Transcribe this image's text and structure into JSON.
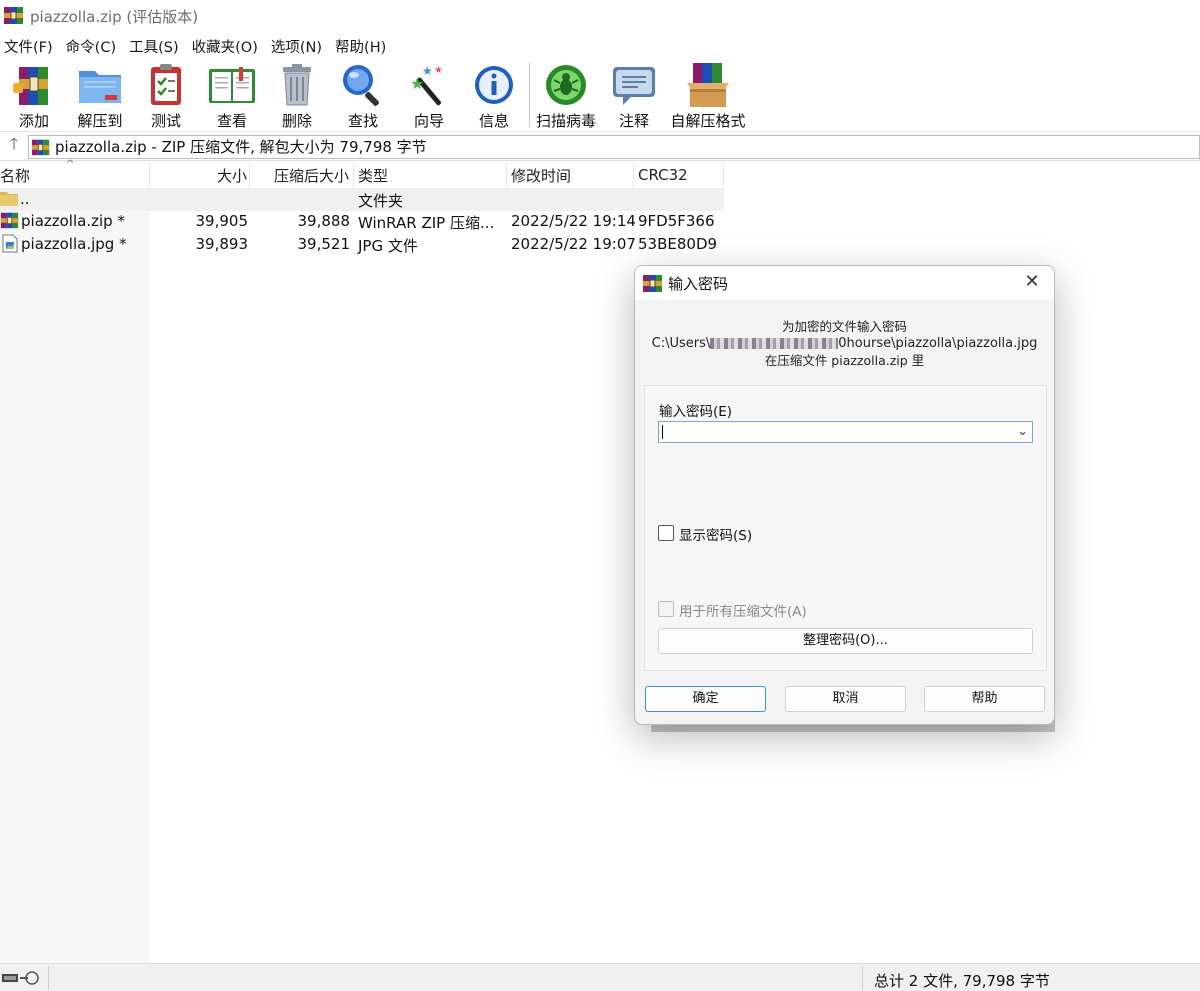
{
  "window": {
    "title": "piazzolla.zip (评估版本)"
  },
  "menu": [
    "文件(F)",
    "命令(C)",
    "工具(S)",
    "收藏夹(O)",
    "选项(N)",
    "帮助(H)"
  ],
  "toolbar": [
    {
      "label": "添加",
      "icon": "add-archive-icon"
    },
    {
      "label": "解压到",
      "icon": "extract-folder-icon"
    },
    {
      "label": "测试",
      "icon": "test-clipboard-icon"
    },
    {
      "label": "查看",
      "icon": "view-book-icon"
    },
    {
      "label": "删除",
      "icon": "trash-bin-icon"
    },
    {
      "label": "查找",
      "icon": "magnifier-icon"
    },
    {
      "label": "向导",
      "icon": "wizard-wand-icon"
    },
    {
      "label": "信息",
      "icon": "info-icon"
    },
    {
      "label": "扫描病毒",
      "icon": "virus-scan-icon"
    },
    {
      "label": "注释",
      "icon": "comment-icon"
    },
    {
      "label": "自解压格式",
      "icon": "sfx-box-icon"
    }
  ],
  "address": {
    "path": "piazzolla.zip - ZIP 压缩文件, 解包大小为 79,798 字节"
  },
  "columns": [
    "名称",
    "大小",
    "压缩后大小",
    "类型",
    "修改时间",
    "CRC32"
  ],
  "rows": [
    {
      "name": "..",
      "size": "",
      "packed": "",
      "type": "文件夹",
      "modified": "",
      "crc": ""
    },
    {
      "name": "piazzolla.zip *",
      "size": "39,905",
      "packed": "39,888",
      "type": "WinRAR ZIP 压缩...",
      "modified": "2022/5/22 19:14",
      "crc": "9FD5F366"
    },
    {
      "name": "piazzolla.jpg *",
      "size": "39,893",
      "packed": "39,521",
      "type": "JPG 文件",
      "modified": "2022/5/22 19:07",
      "crc": "53BE80D9"
    }
  ],
  "status": {
    "summary": "总计 2 文件, 79,798 字节"
  },
  "dialog": {
    "title": "输入密码",
    "close": "✕",
    "info_line1": "为加密的文件输入密码",
    "path_prefix": "C:\\Users\\",
    "path_suffix": "0hourse\\piazzolla\\piazzolla.jpg",
    "info_line3_prefix": "在压缩文件",
    "info_line3_suffix": " piazzolla.zip 里",
    "password_label": "输入密码(E)",
    "password_value": "",
    "show_password": "显示密码(S)",
    "use_for_all": "用于所有压缩文件(A)",
    "organize": "整理密码(O)...",
    "ok": "确定",
    "cancel": "取消",
    "help": "帮助"
  }
}
